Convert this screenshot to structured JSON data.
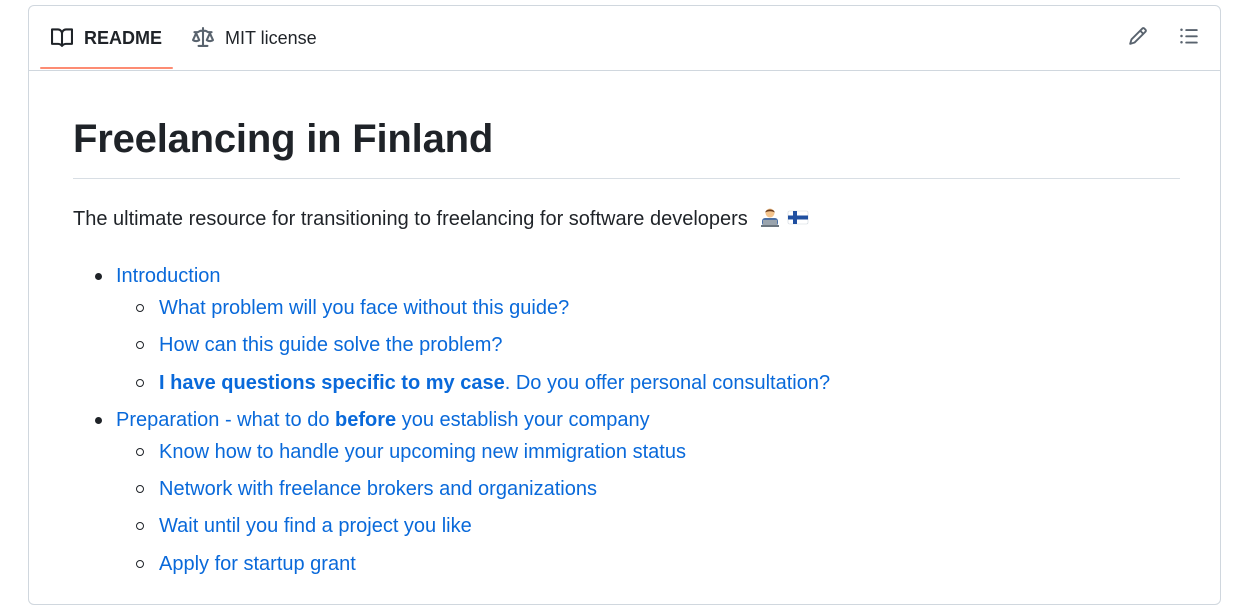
{
  "tabs": {
    "readme": {
      "label": "README",
      "icon": "book-icon",
      "active": true
    },
    "license": {
      "label": "MIT license",
      "icon": "scale-icon"
    }
  },
  "actions": {
    "edit_icon": "pencil-icon",
    "toc_icon": "list-icon"
  },
  "colors": {
    "link": "#0969da",
    "text": "#1f2328",
    "border": "#d0d7de",
    "active_tab_underline": "#fd8c73"
  },
  "readme": {
    "title": "Freelancing in Finland",
    "intro": "The ultimate resource for transitioning to freelancing for software developers",
    "intro_emoji": [
      "technologist-emoji",
      "finland-flag-emoji"
    ],
    "toc": [
      {
        "label": "Introduction",
        "children": [
          {
            "label": "What problem will you face without this guide?"
          },
          {
            "label": "How can this guide solve the problem?"
          },
          {
            "label_bold": "I have questions specific to my case",
            "label_rest": ". Do you offer personal consultation?"
          }
        ]
      },
      {
        "label_pre": "Preparation - what to do ",
        "label_bold": "before",
        "label_post": " you establish your company",
        "children": [
          {
            "label": "Know how to handle your upcoming new immigration status"
          },
          {
            "label": "Network with freelance brokers and organizations"
          },
          {
            "label": "Wait until you find a project you like"
          },
          {
            "label": "Apply for startup grant"
          }
        ]
      }
    ]
  }
}
